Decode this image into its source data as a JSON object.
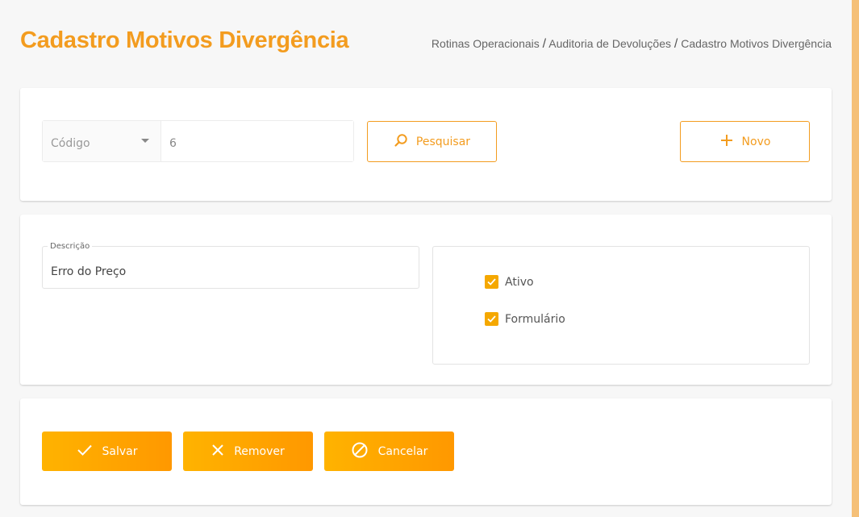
{
  "header": {
    "title": "Cadastro Motivos Divergência",
    "breadcrumb": [
      "Rotinas Operacionais",
      "Auditoria de Devoluções",
      "Cadastro Motivos Divergência"
    ],
    "breadcrumb_separator": "/"
  },
  "search": {
    "field_select": "Código",
    "query_value": "6",
    "search_label": "Pesquisar",
    "new_label": "Novo"
  },
  "form": {
    "description_label": "Descrição",
    "description_value": "Erro do Preço",
    "checkboxes": [
      {
        "label": "Ativo",
        "checked": true
      },
      {
        "label": "Formulário",
        "checked": true
      }
    ]
  },
  "actions": {
    "save_label": "Salvar",
    "remove_label": "Remover",
    "cancel_label": "Cancelar"
  },
  "colors": {
    "accent": "#f39c1f",
    "button_gradient_start": "#ffb300",
    "button_gradient_end": "#ff9800",
    "checkbox": "#f5a800"
  },
  "icons": {
    "search": "search-icon",
    "new": "plus-icon",
    "save": "check-icon",
    "remove": "close-icon",
    "cancel": "ban-icon",
    "select": "caret-down-icon"
  }
}
